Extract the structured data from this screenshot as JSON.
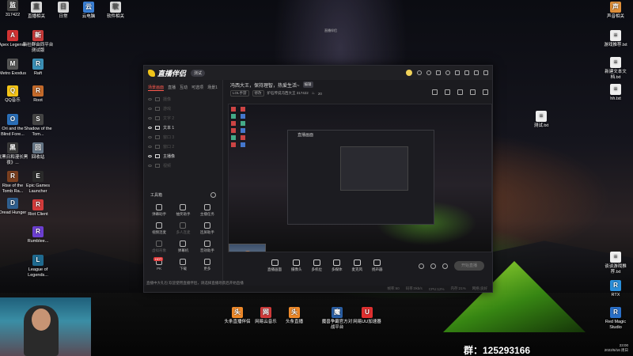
{
  "desktop": {
    "icons_left": [
      {
        "label": "317422",
        "color": "#444444",
        "glyph": "监"
      },
      {
        "label": "Apex Legends",
        "color": "#d23333",
        "glyph": "A"
      },
      {
        "label": "Metro Exodus",
        "color": "#555555",
        "glyph": "M"
      },
      {
        "label": "QQ音乐",
        "color": "#f5c518",
        "glyph": "Q"
      },
      {
        "label": "Ori and the Blind Fore...",
        "color": "#2a6fb8",
        "glyph": "O"
      },
      {
        "label": "《黑日和漫长黑夜》...",
        "color": "#3a3a3a",
        "glyph": "黑"
      },
      {
        "label": "Rise of the Tomb Ra...",
        "color": "#7a3f1f",
        "glyph": "R"
      },
      {
        "label": "Dread Hunger",
        "color": "#2f5f8f",
        "glyph": "D"
      }
    ],
    "icons_col2": [
      {
        "label": "新社群由同平台测试版",
        "color": "#c83a3a",
        "glyph": "新"
      },
      {
        "label": "Raft",
        "color": "#3b8fb5",
        "glyph": "R"
      },
      {
        "label": "Root",
        "color": "#c46a2b",
        "glyph": "R"
      },
      {
        "label": "Shadow of the Tom...",
        "color": "#444444",
        "glyph": "S"
      },
      {
        "label": "回收站",
        "color": "#667788",
        "glyph": "回"
      },
      {
        "label": "Epic Games Launcher",
        "color": "#2a2a2a",
        "glyph": "E"
      },
      {
        "label": "Riot Client",
        "color": "#d33b3b",
        "glyph": "R"
      },
      {
        "label": "Rumblee...",
        "color": "#6c3fd1",
        "glyph": "R"
      },
      {
        "label": "League of Legends...",
        "color": "#1f6a8f",
        "glyph": "L"
      }
    ],
    "icons_top": [
      {
        "label": "直播相关",
        "color": "#dcdcdc",
        "glyph": "直"
      },
      {
        "label": "日常",
        "color": "#dcdcdc",
        "glyph": "日"
      },
      {
        "label": "云电脑",
        "color": "#3a7fd5",
        "glyph": "云"
      },
      {
        "label": "软件相关",
        "color": "#dcdcdc",
        "glyph": "软"
      }
    ],
    "icons_right": [
      {
        "label": "声音相关",
        "color": "#e0903a",
        "glyph": "声"
      },
      {
        "label": "游戏推荐.txt",
        "color": "#eeeeee",
        "glyph": "≡"
      },
      {
        "label": "新建文本文档.txt",
        "color": "#eeeeee",
        "glyph": "≡"
      },
      {
        "label": "hh.txt",
        "color": "#eeeeee",
        "glyph": "≡"
      },
      {
        "label": "谈谈游戏推荐.txt",
        "color": "#eeeeee",
        "glyph": "≡"
      },
      {
        "label": "RTX",
        "color": "#2a8fdb",
        "glyph": "R"
      },
      {
        "label": "Red Magic Studio",
        "color": "#2a70c9",
        "glyph": "R"
      }
    ],
    "icons_bottom": [
      {
        "label": "头条直播伴侣",
        "color": "#f08a2a",
        "glyph": "头"
      },
      {
        "label": "网易云音乐",
        "color": "#d33b3b",
        "glyph": "网"
      },
      {
        "label": "头条直播",
        "color": "#f08a2a",
        "glyph": "头"
      },
      {
        "label": "魔兽争霸官方对战平台",
        "color": "#2a5fa5",
        "glyph": "魔"
      },
      {
        "label": "网易UU加速器",
        "color": "#e03030",
        "glyph": "U"
      }
    ],
    "mid_file": {
      "label": "测试.txt",
      "color": "#eeeeee",
      "glyph": "≡"
    },
    "group_text": "群：125293166",
    "tray_time": "23:00",
    "tray_date": "2022/5/16 周日",
    "watermark": "直播伴侣"
  },
  "window": {
    "app_name": "直播伴侣",
    "version": "测试",
    "left_tabs": [
      "场景画面",
      "直播",
      "互动",
      "可选项",
      "场景1"
    ],
    "sources": [
      {
        "label": "摄像",
        "on": false
      },
      {
        "label": "游戏",
        "on": false
      },
      {
        "label": "文字 2",
        "on": false
      },
      {
        "label": "文本 1",
        "on": true
      },
      {
        "label": "窗口 3",
        "on": false
      },
      {
        "label": "窗口 2",
        "on": false
      },
      {
        "label": "主播像",
        "on": true
      },
      {
        "label": "视频",
        "on": false
      }
    ],
    "tools_title": "工具箱",
    "tools": [
      {
        "label": "弹幕助手",
        "dim": false
      },
      {
        "label": "抽奖助手",
        "dim": false
      },
      {
        "label": "主播任务",
        "dim": false
      },
      {
        "label": "视频连麦",
        "dim": false
      },
      {
        "label": "多人连麦",
        "dim": true
      },
      {
        "label": "连屏助手",
        "dim": false
      },
      {
        "label": "虚拟形象",
        "dim": true
      },
      {
        "label": "弹幕机",
        "dim": false
      },
      {
        "label": "音效助手",
        "dim": false
      },
      {
        "label": "PK",
        "dim": false
      },
      {
        "label": "下载",
        "dim": false
      },
      {
        "label": "更多",
        "dim": false
      }
    ],
    "hot_badge": "HOT",
    "footer_note": "直播中大礼包    欢迎使用直播伴侣，请选择直播场景后开始直播",
    "header_title": "冯西大王，保持理智，热爱生活~",
    "header_badge": "编辑",
    "sub_chips": [
      "LOL手游",
      "修改"
    ],
    "sub_text": "炉石传说冯西大王  317422",
    "sub_fans": "20",
    "preview_ontop_label": "直播画面",
    "controls": [
      {
        "label": "直播画面"
      },
      {
        "label": "摄像头"
      },
      {
        "label": "多机位"
      },
      {
        "label": "多媒体"
      },
      {
        "label": "麦克风"
      },
      {
        "label": "扬声器"
      }
    ],
    "go_live": "开始直播",
    "status_items": [
      "帧率:60",
      "码率:0kb/s",
      "CPU:12%",
      "内存:21%",
      "网络:良好"
    ]
  }
}
